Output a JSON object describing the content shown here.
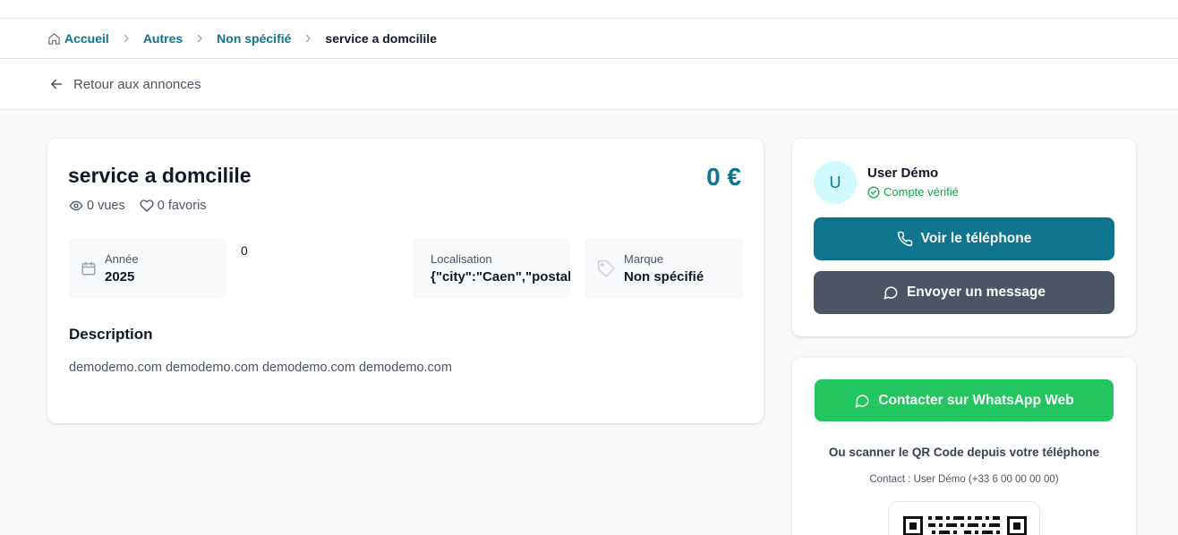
{
  "breadcrumb": {
    "home": "Accueil",
    "items": [
      "Autres",
      "Non spécifié"
    ],
    "current": "service a domcilile"
  },
  "back": {
    "label": "Retour aux annonces"
  },
  "listing": {
    "title": "service a domcilile",
    "price": "0 €",
    "views": "0 vues",
    "favorites": "0 favoris",
    "stray_value": "0",
    "info": [
      {
        "label": "Année",
        "value": "2025",
        "icon": "calendar-icon"
      },
      {
        "label": "Localisation",
        "value": "{\"city\":\"Caen\",\"postalCo",
        "icon": ""
      },
      {
        "label": "Marque",
        "value": "Non spécifié",
        "icon": "tag-icon"
      }
    ],
    "description_title": "Description",
    "description": "demodemo.com demodemo.com demodemo.com demodemo.com"
  },
  "seller": {
    "initial": "U",
    "name": "User Démo",
    "verified": "Compte vérifié",
    "phone_button": "Voir le téléphone",
    "message_button": "Envoyer un message"
  },
  "whatsapp": {
    "button": "Contacter sur WhatsApp Web",
    "scan_text": "Ou scanner le QR Code depuis votre téléphone",
    "contact_text": "Contact : User Démo (+33 6 00 00 00 00)"
  },
  "colors": {
    "accent": "#0e7490",
    "dark_button": "#4b5563",
    "whatsapp": "#22c55e",
    "verified": "#16a34a"
  }
}
